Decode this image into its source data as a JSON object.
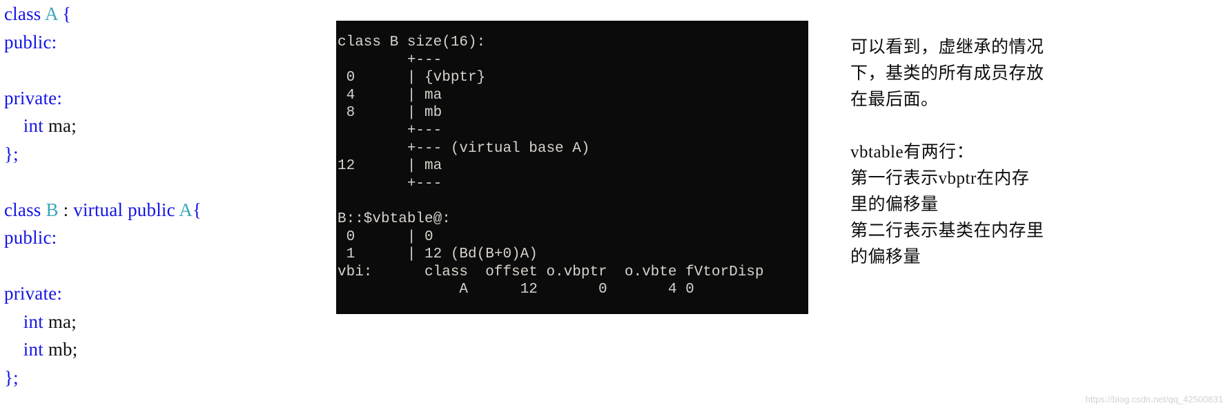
{
  "code_pane": {
    "language": "cpp",
    "lines": [
      [
        {
          "t": "class ",
          "c": "kw"
        },
        {
          "t": "A",
          "c": "type"
        },
        {
          "t": " {",
          "c": "kw"
        }
      ],
      [
        {
          "t": "public:",
          "c": "kw"
        }
      ],
      [],
      [
        {
          "t": "private:",
          "c": "kw"
        }
      ],
      [
        {
          "t": "    int ",
          "c": "kw"
        },
        {
          "t": "ma;",
          "c": "ident"
        }
      ],
      [
        {
          "t": "};",
          "c": "kw"
        }
      ],
      [],
      [
        {
          "t": "class ",
          "c": "kw"
        },
        {
          "t": "B",
          "c": "type"
        },
        {
          "t": " : ",
          "c": "punct"
        },
        {
          "t": "virtual public ",
          "c": "kw"
        },
        {
          "t": "A",
          "c": "type"
        },
        {
          "t": "{",
          "c": "kw"
        }
      ],
      [
        {
          "t": "public:",
          "c": "kw"
        }
      ],
      [],
      [
        {
          "t": "private:",
          "c": "kw"
        }
      ],
      [
        {
          "t": "    int ",
          "c": "kw"
        },
        {
          "t": "ma;",
          "c": "ident"
        }
      ],
      [
        {
          "t": "    int ",
          "c": "kw"
        },
        {
          "t": "mb;",
          "c": "ident"
        }
      ],
      [
        {
          "t": "};",
          "c": "kw"
        }
      ]
    ]
  },
  "console_pane": {
    "title": "class B size(16):",
    "lines": [
      "class B size(16):",
      "        +---",
      " 0      | {vbptr}",
      " 4      | ma",
      " 8      | mb",
      "        +---",
      "        +--- (virtual base A)",
      "12      | ma",
      "        +---",
      "",
      "B::$vbtable@:",
      " 0      | 0",
      " 1      | 12 (Bd(B+0)A)",
      "vbi:      class  offset o.vbptr  o.vbte fVtorDisp",
      "              A      12       0       4 0"
    ],
    "layout": {
      "class_name": "B",
      "size_bytes": 16,
      "members": [
        {
          "offset": "0",
          "name": "{vbptr}"
        },
        {
          "offset": "4",
          "name": "ma"
        },
        {
          "offset": "8",
          "name": "mb"
        }
      ],
      "virtual_base_label": "(virtual base A)",
      "virtual_base_members": [
        {
          "offset": "12",
          "name": "ma"
        }
      ],
      "vbtable_label": "B::$vbtable@:",
      "vbtable_rows": [
        {
          "index": "0",
          "value": "0"
        },
        {
          "index": "1",
          "value": "12 (Bd(B+0)A)"
        }
      ],
      "vbi_headers": [
        "vbi:",
        "class",
        "offset",
        "o.vbptr",
        "o.vbte",
        "fVtorDisp"
      ],
      "vbi_row": [
        "A",
        "12",
        "0",
        "4",
        "0"
      ]
    }
  },
  "notes_pane": {
    "paragraph_1": "可以看到，虚继承的情况\n下，基类的所有成员存放\n在最后面。",
    "paragraph_2": "vbtable有两行：\n第一行表示vbptr在内存\n里的偏移量\n第二行表示基类在内存里\n的偏移量"
  },
  "watermark": {
    "text": "https://blog.csdn.net/qq_42500831"
  },
  "colors": {
    "keyword": "#1414e6",
    "type": "#3aa6bd",
    "identifier": "#111111",
    "console_bg": "#0b0b0b",
    "console_fg": "#d7d3cb",
    "page_bg": "#ffffff",
    "watermark": "#d2d2d2"
  }
}
